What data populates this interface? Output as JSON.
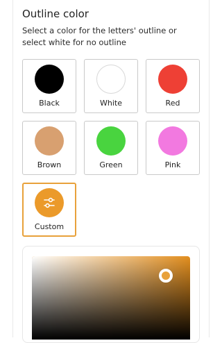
{
  "section": {
    "title": "Outline color",
    "description": "Select a color for the letters' outline or select white for no outline"
  },
  "options": [
    {
      "label": "Black",
      "color": "#000000",
      "icon": "color-swatch"
    },
    {
      "label": "White",
      "color": "#ffffff",
      "icon": "color-swatch"
    },
    {
      "label": "Red",
      "color": "#ee4035",
      "icon": "color-swatch"
    },
    {
      "label": "Brown",
      "color": "#d8a070",
      "icon": "color-swatch"
    },
    {
      "label": "Green",
      "color": "#49d43f",
      "icon": "color-swatch"
    },
    {
      "label": "Pink",
      "color": "#f279e0",
      "icon": "color-swatch"
    },
    {
      "label": "Custom",
      "color": "#eb9a2a",
      "icon": "sliders-icon",
      "selected": true
    }
  ],
  "picker": {
    "hue_color": "#e38f1f",
    "selected_color": "#e8a13a"
  }
}
